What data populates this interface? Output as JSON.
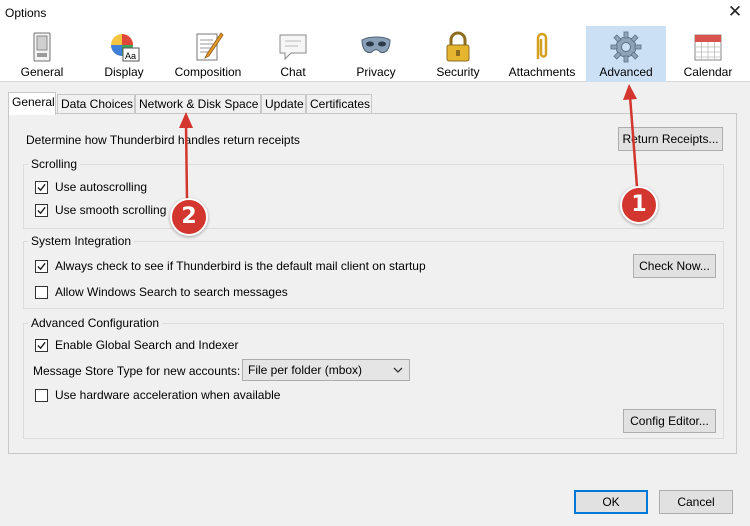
{
  "window": {
    "title": "Options",
    "close_glyph": "✕"
  },
  "panes": [
    {
      "label": "General",
      "icon": "general-pane-icon"
    },
    {
      "label": "Display",
      "icon": "display-pane-icon"
    },
    {
      "label": "Composition",
      "icon": "composition-pane-icon"
    },
    {
      "label": "Chat",
      "icon": "chat-bubble-icon"
    },
    {
      "label": "Privacy",
      "icon": "privacy-mask-icon"
    },
    {
      "label": "Security",
      "icon": "padlock-icon"
    },
    {
      "label": "Attachments",
      "icon": "paperclip-icon"
    },
    {
      "label": "Advanced",
      "icon": "gear-icon",
      "selected": true
    },
    {
      "label": "Calendar",
      "icon": "calendar-icon"
    }
  ],
  "tabs": [
    {
      "label": "General",
      "active": true
    },
    {
      "label": "Data Choices"
    },
    {
      "label": "Network & Disk Space"
    },
    {
      "label": "Update"
    },
    {
      "label": "Certificates"
    }
  ],
  "receipts": {
    "text": "Determine how Thunderbird handles return receipts",
    "button": "Return Receipts..."
  },
  "scrolling": {
    "caption": "Scrolling",
    "autoscroll": {
      "label": "Use autoscrolling",
      "checked": true
    },
    "smooth": {
      "label": "Use smooth scrolling",
      "checked": true
    }
  },
  "system_integration": {
    "caption": "System Integration",
    "default_check": {
      "label": "Always check to see if Thunderbird is the default mail client on startup",
      "checked": true
    },
    "check_now_button": "Check Now...",
    "windows_search": {
      "label": "Allow Windows Search to search messages",
      "checked": false
    }
  },
  "advanced_config": {
    "caption": "Advanced Configuration",
    "global_search": {
      "label": "Enable Global Search and Indexer",
      "checked": true
    },
    "store_type_label": "Message Store Type for new accounts:",
    "store_type_value": "File per folder (mbox)",
    "hw_accel": {
      "label": "Use hardware acceleration when available",
      "checked": false
    },
    "config_editor_button": "Config Editor..."
  },
  "footer": {
    "ok": "OK",
    "cancel": "Cancel"
  },
  "annotations": [
    {
      "number": "1",
      "color": "#d2362e"
    },
    {
      "number": "2",
      "color": "#d2362e"
    }
  ],
  "colors": {
    "selected_pane": "#cce0f5",
    "accent": "#0078d7",
    "annotation": "#d2362e"
  }
}
